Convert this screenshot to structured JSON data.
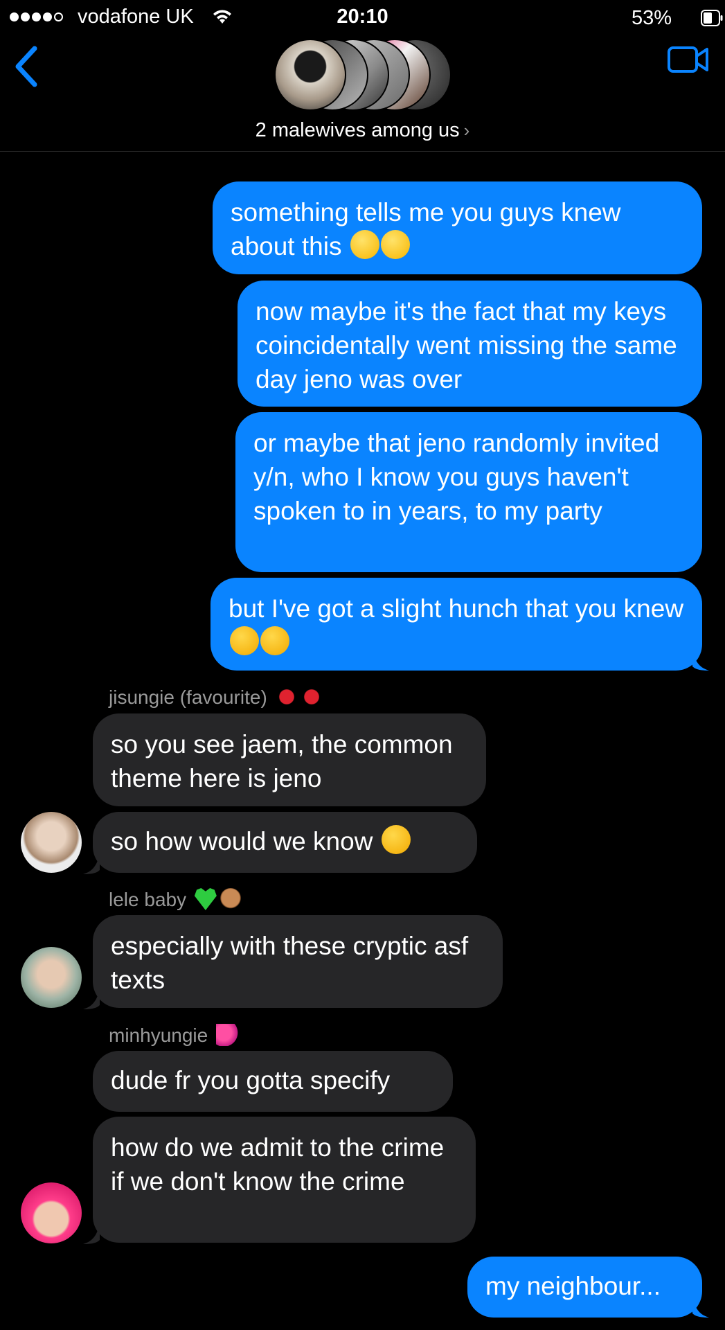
{
  "status_bar": {
    "carrier": "vodafone UK",
    "time": "20:10",
    "battery_percent": "53%",
    "signal_bars_filled": 4,
    "signal_bars_total": 5
  },
  "header": {
    "group_name": "2 malewives among us",
    "back_icon": "chevron-left-icon",
    "video_icon": "video-camera-icon",
    "accent_color": "#0a84ff"
  },
  "messages": {
    "m1": {
      "text": "something tells me you guys knew about this"
    },
    "m2": {
      "text": "now maybe it's the fact that my keys coincidentally went missing the same day jeno was over"
    },
    "m3": {
      "text": "or maybe that jeno randomly invited y/n, who I know you guys haven't spoken to in years, to my party"
    },
    "m4": {
      "text": "but I've got a slight hunch that you knew"
    },
    "sender1": "jisungie (favourite)",
    "m5": {
      "text": "so you see jaem, the common theme here is jeno"
    },
    "m6": {
      "text": "so how would we know"
    },
    "sender2": "lele baby",
    "m7": {
      "text": "especially with these cryptic asf texts"
    },
    "sender3": "minhyungie",
    "m8": {
      "text": "dude fr you gotta specify"
    },
    "m9": {
      "text": "how do we admit to the crime if we don't know the crime"
    },
    "m10": {
      "text": "my neighbour..."
    }
  },
  "colors": {
    "outgoing_bubble": "#0a84ff",
    "incoming_bubble": "#262628",
    "sender_text": "#9a9a9a"
  }
}
